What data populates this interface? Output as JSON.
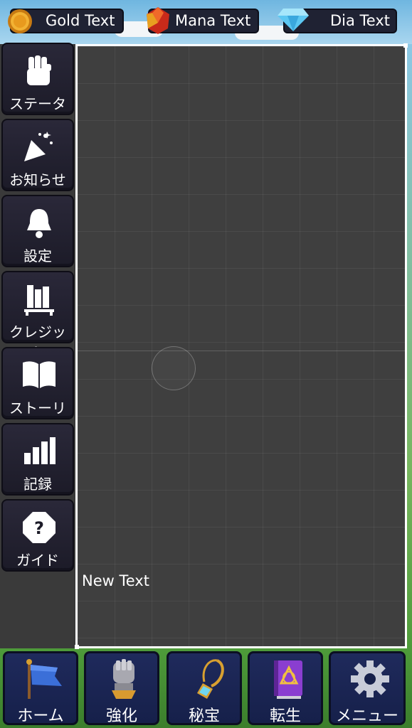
{
  "currencies": [
    {
      "label": "Gold Text",
      "icon": "gold-coin-icon"
    },
    {
      "label": "Mana Text",
      "icon": "mana-gem-icon"
    },
    {
      "label": "Dia Text",
      "icon": "diamond-icon"
    }
  ],
  "side_menu": [
    {
      "label": "ステータス",
      "icon": "fist-icon"
    },
    {
      "label": "お知らせ",
      "icon": "party-popper-icon"
    },
    {
      "label": "設定",
      "icon": "bell-icon"
    },
    {
      "label": "クレジット",
      "icon": "books-icon"
    },
    {
      "label": "ストーリー",
      "icon": "open-book-icon"
    },
    {
      "label": "記録",
      "icon": "bar-chart-icon"
    },
    {
      "label": "ガイド",
      "icon": "question-octagon-icon"
    }
  ],
  "panel": {
    "text": "New Text"
  },
  "bottom_nav": [
    {
      "label": "ホーム",
      "icon": "home-flag-icon"
    },
    {
      "label": "強化",
      "icon": "gauntlet-icon"
    },
    {
      "label": "秘宝",
      "icon": "amulet-icon"
    },
    {
      "label": "転生",
      "icon": "spellbook-icon"
    },
    {
      "label": "メニュー",
      "icon": "gear-icon"
    }
  ]
}
